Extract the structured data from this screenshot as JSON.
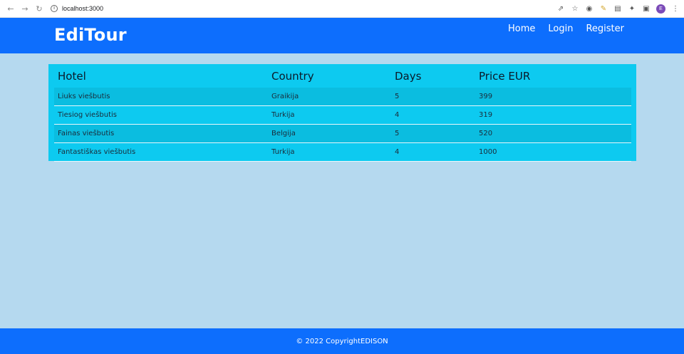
{
  "browser": {
    "url": "localhost:3000",
    "profile_initial": "E"
  },
  "navbar": {
    "brand": "EdiTour",
    "links": [
      "Home",
      "Login",
      "Register"
    ]
  },
  "table": {
    "headers": [
      "Hotel",
      "Country",
      "Days",
      "Price EUR"
    ],
    "rows": [
      [
        "Liuks viešbutis",
        "Graikija",
        "5",
        "399"
      ],
      [
        "Tiesiog viešbutis",
        "Turkija",
        "4",
        "319"
      ],
      [
        "Fainas viešbutis",
        "Belgija",
        "5",
        "520"
      ],
      [
        "Fantastiškas viešbutis",
        "Turkija",
        "4",
        "1000"
      ]
    ]
  },
  "footer": {
    "text": "© 2022 CopyrightEDISON"
  },
  "colors": {
    "navbar": "#0d6efd",
    "table": "#0dcaf0",
    "page_bg": "#b5d9ef"
  }
}
